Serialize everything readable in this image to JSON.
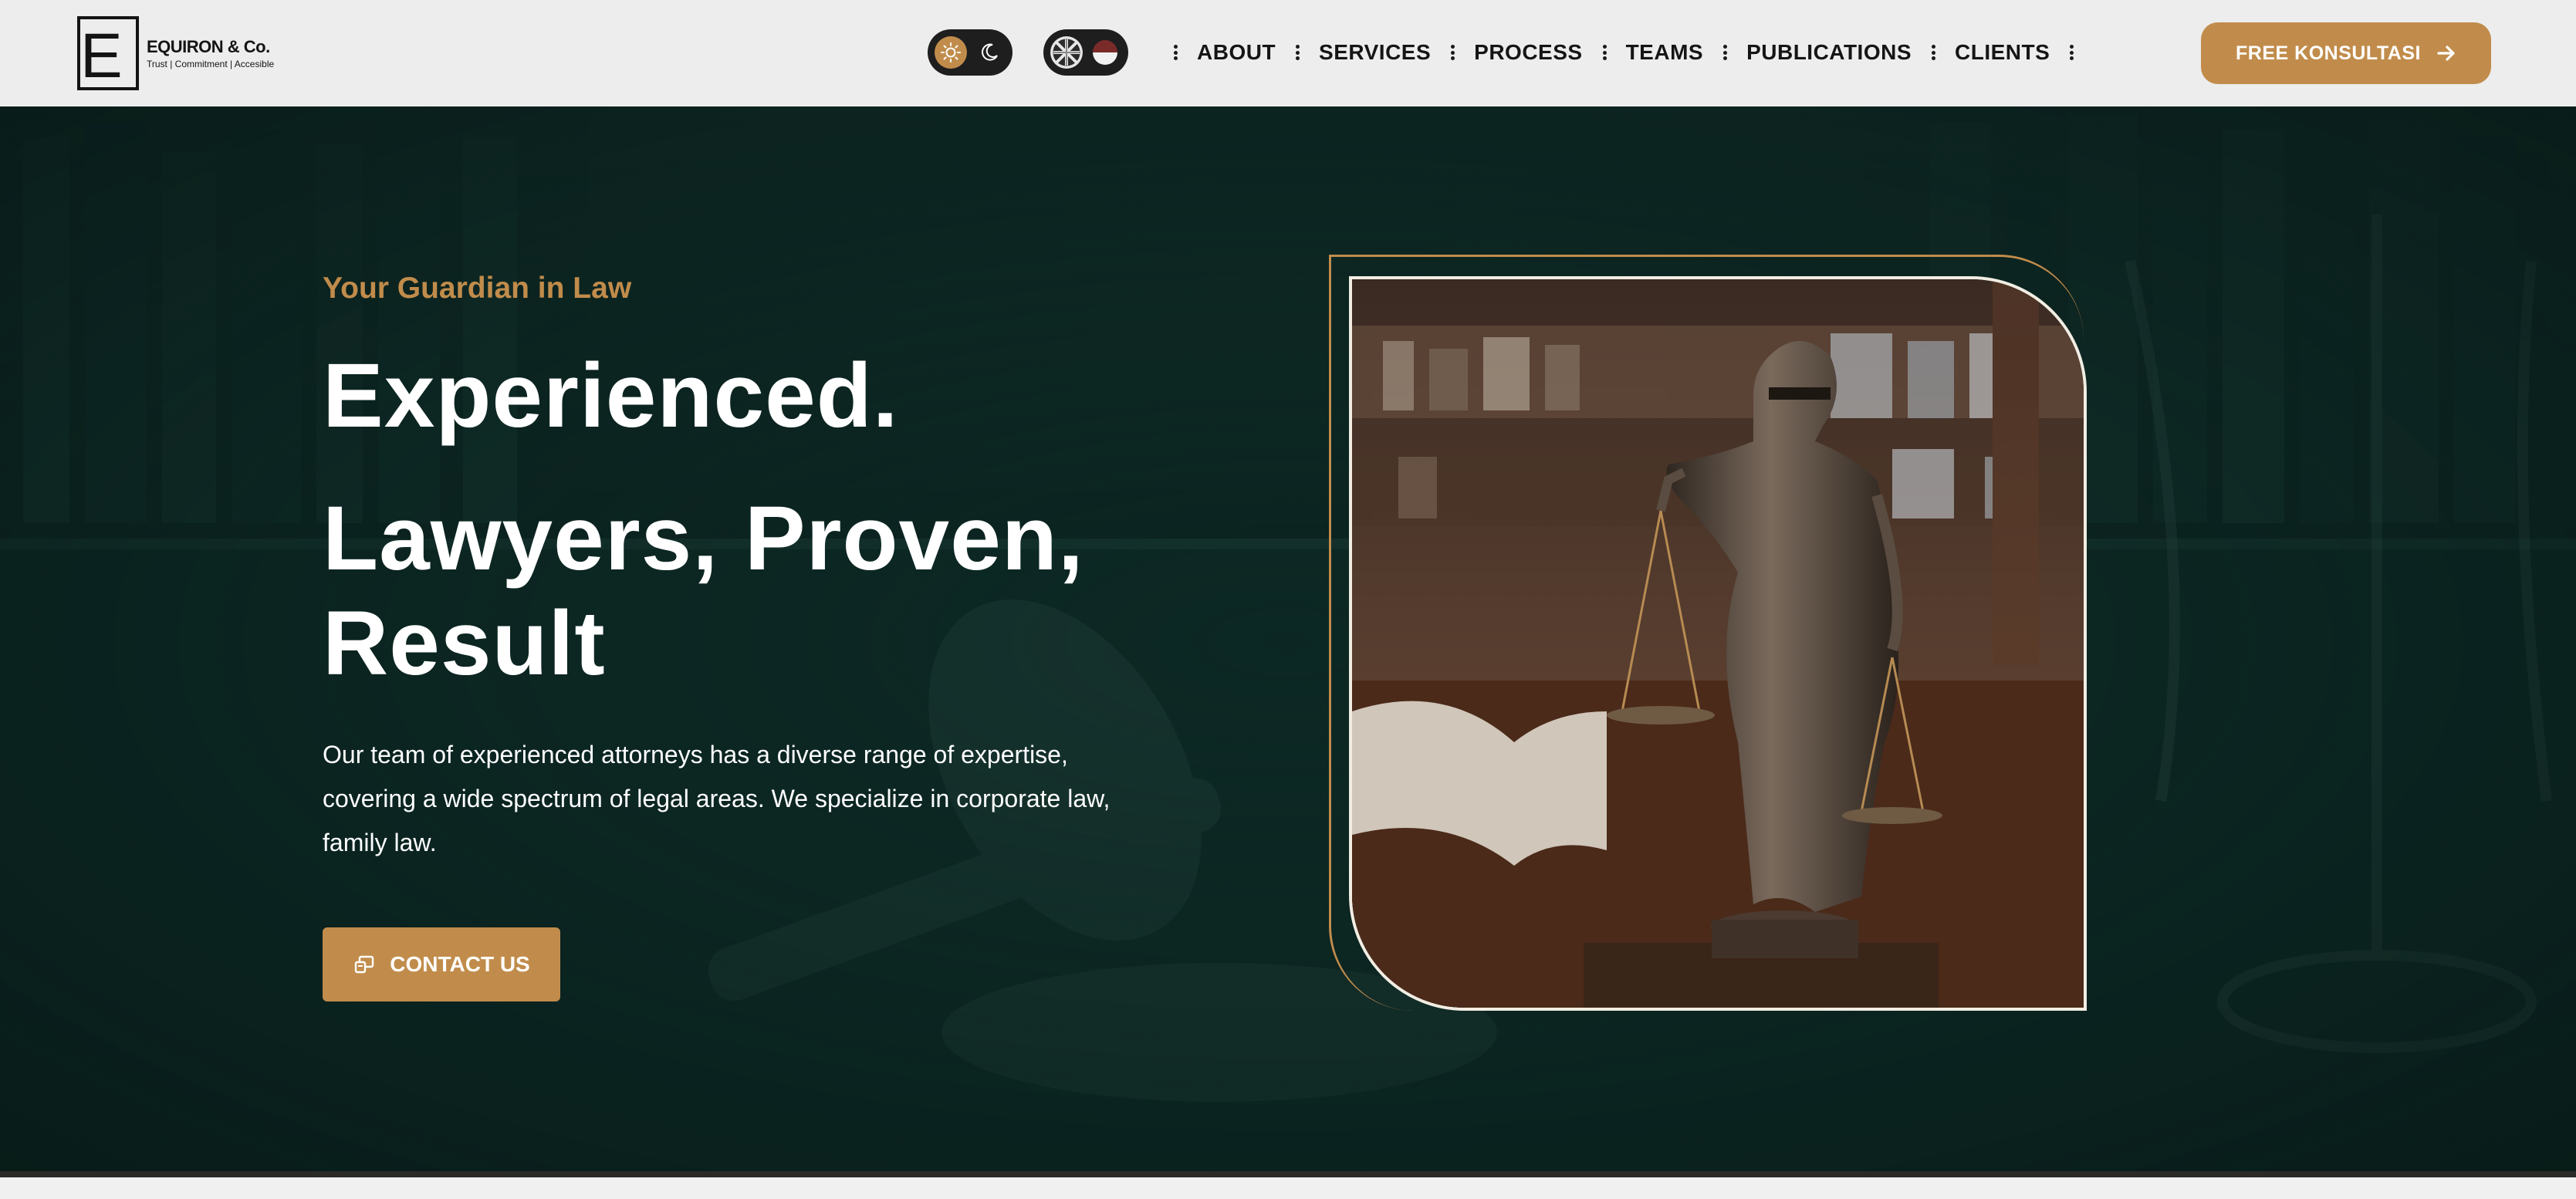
{
  "brand": {
    "letter": "E",
    "name": "EQUIRON & Co.",
    "tagline": "Trust | Commitment | Accesible"
  },
  "toggles": {
    "theme": [
      "sun-icon",
      "moon-icon"
    ],
    "language": [
      "uk-flag-icon",
      "indonesia-flag-icon"
    ]
  },
  "nav": {
    "items": [
      "ABOUT",
      "SERVICES",
      "PROCESS",
      "TEAMS",
      "PUBLICATIONS",
      "CLIENTS"
    ],
    "cta_label": "FREE KONSULTASI"
  },
  "hero": {
    "eyebrow": "Your Guardian in Law",
    "headline_line1": "Experienced.",
    "headline_line2": "Lawyers, Proven, Result",
    "lead": "Our team of experienced attorneys has a diverse range of expertise, covering a wide spectrum of legal areas. We specialize in corporate law, family law.",
    "contact_label": "CONTACT US",
    "image": "lady-justice-statue-image"
  },
  "colors": {
    "accent": "#c18c4b",
    "hero_bg": "#0b2320",
    "header_bg": "#ededed",
    "text_dark": "#151515"
  }
}
